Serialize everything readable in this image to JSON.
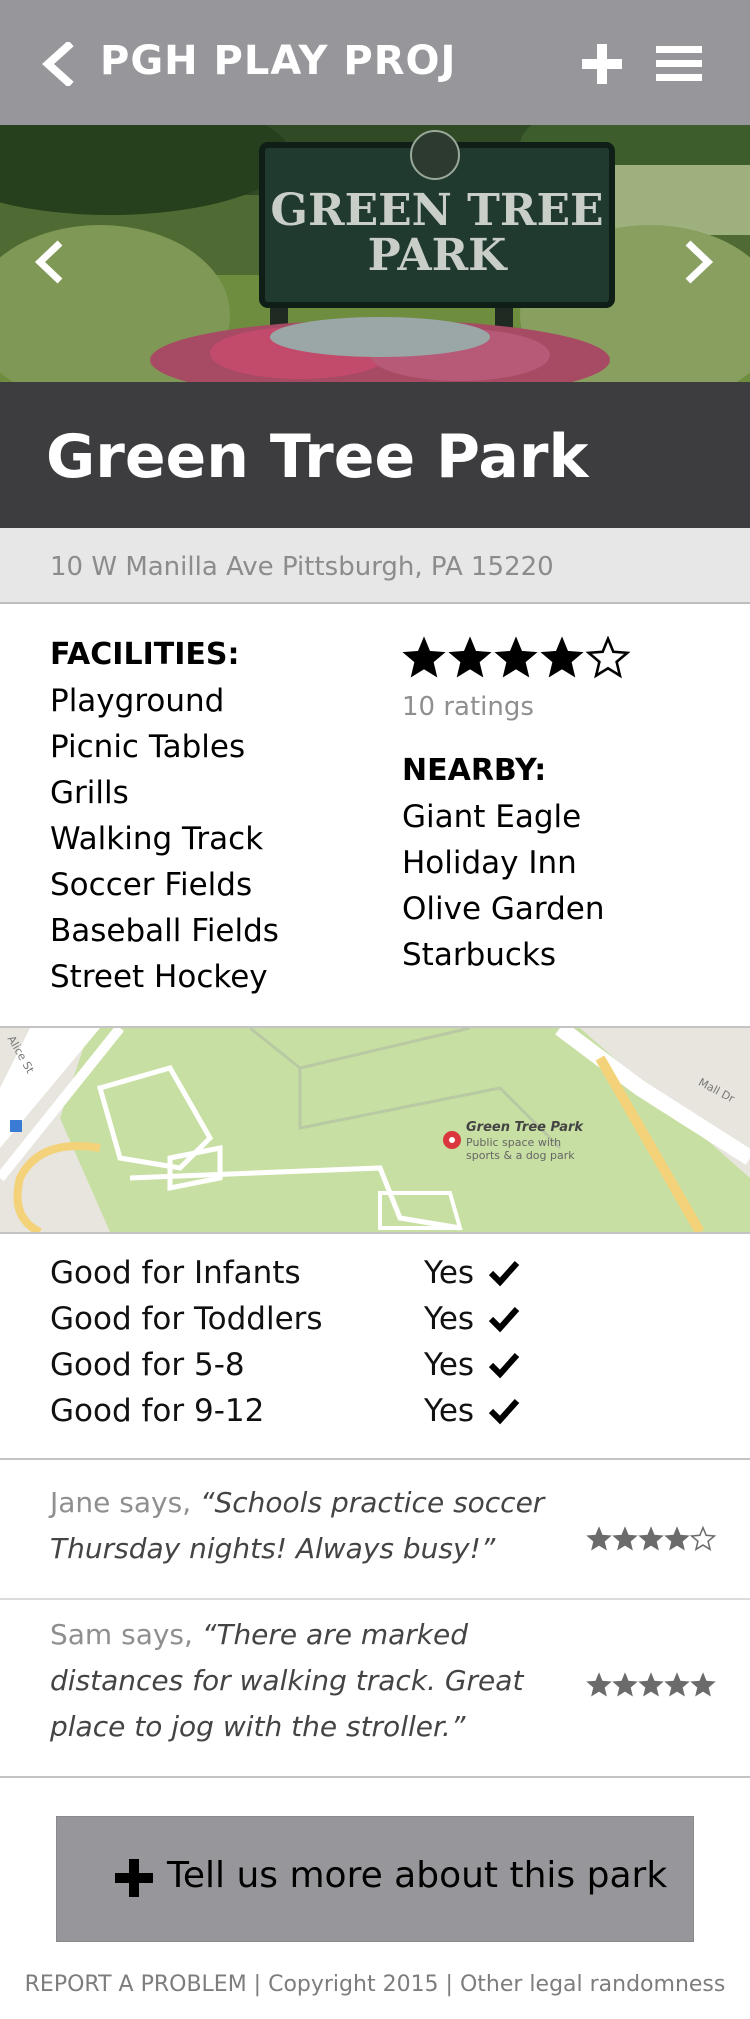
{
  "header": {
    "title": "PGH PLAY PROJ",
    "back_icon": "chevron-left-icon",
    "add_icon": "plus-icon",
    "menu_icon": "hamburger-menu-icon",
    "background": "#97979b"
  },
  "hero": {
    "sign_line1": "GREEN TREE",
    "sign_line2": "PARK",
    "prev_icon": "chevron-left-icon",
    "next_icon": "chevron-right-icon"
  },
  "park": {
    "name": "Green Tree Park",
    "address": "10 W Manilla Ave Pittsburgh, PA 15220"
  },
  "facilities": {
    "heading": "FACILITIES:",
    "items": [
      "Playground",
      "Picnic Tables",
      "Grills",
      "Walking Track",
      "Soccer Fields",
      "Baseball Fields",
      "Street Hockey"
    ]
  },
  "rating": {
    "stars": 4,
    "max": 5,
    "count_text": "10 ratings"
  },
  "nearby": {
    "heading": "NEARBY:",
    "items": [
      "Giant Eagle",
      "Holiday Inn",
      "Olive Garden",
      "Starbucks"
    ]
  },
  "map": {
    "place_name": "Green Tree Park",
    "place_desc": "Public space with sports & a dog park",
    "street_a": "Alice St",
    "street_b": "Mall Dr"
  },
  "ages": [
    {
      "label": "Good for Infants",
      "value": "Yes"
    },
    {
      "label": "Good for Toddlers",
      "value": "Yes"
    },
    {
      "label": "Good for 5-8",
      "value": "Yes"
    },
    {
      "label": "Good for 9-12",
      "value": "Yes"
    }
  ],
  "reviews": [
    {
      "name": "Jane says,",
      "quote": "“Schools practice soccer Thursday nights! Always busy!”",
      "stars": 4
    },
    {
      "name": "Sam says,",
      "quote": "“There are marked distances for walking track. Great place to jog with the stroller.”",
      "stars": 5
    }
  ],
  "cta": {
    "label": "Tell us more about this park",
    "icon": "plus-icon"
  },
  "footer": {
    "report": "REPORT A PROBLEM",
    "sep1": " | ",
    "copyright": "Copyright 2015",
    "sep2": " | ",
    "legal": "Other legal randomness"
  },
  "colors": {
    "title_band": "#3d3d3f",
    "address_band": "#e7e7e8",
    "muted_text": "#8f8f8f"
  }
}
